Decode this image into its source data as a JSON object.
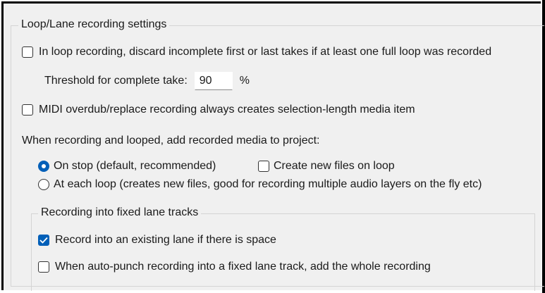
{
  "group_title": "Loop/Lane recording settings",
  "discard_takes": {
    "label": "In loop recording, discard incomplete first or last takes if at least one full loop was recorded",
    "checked": false
  },
  "threshold": {
    "label": "Threshold for complete take:",
    "value": "90",
    "unit": "%"
  },
  "midi_overdub": {
    "label": "MIDI overdub/replace recording always creates selection-length media item",
    "checked": false
  },
  "looped_heading": "When recording and looped, add recorded media to project:",
  "on_stop": {
    "label": "On stop (default, recommended)",
    "selected": true
  },
  "create_new_files": {
    "label": "Create new files on loop",
    "checked": false
  },
  "each_loop": {
    "label": "At each loop (creates new files, good for recording multiple audio layers on the fly etc)",
    "selected": false
  },
  "lane_group_title": "Recording into fixed lane tracks",
  "existing_lane": {
    "label": "Record into an existing lane if there is space",
    "checked": true
  },
  "auto_punch": {
    "label": "When auto-punch recording into a fixed lane track, add the whole recording",
    "checked": false
  },
  "colors": {
    "accent": "#005fb8",
    "panel": "#f0f0f0"
  }
}
